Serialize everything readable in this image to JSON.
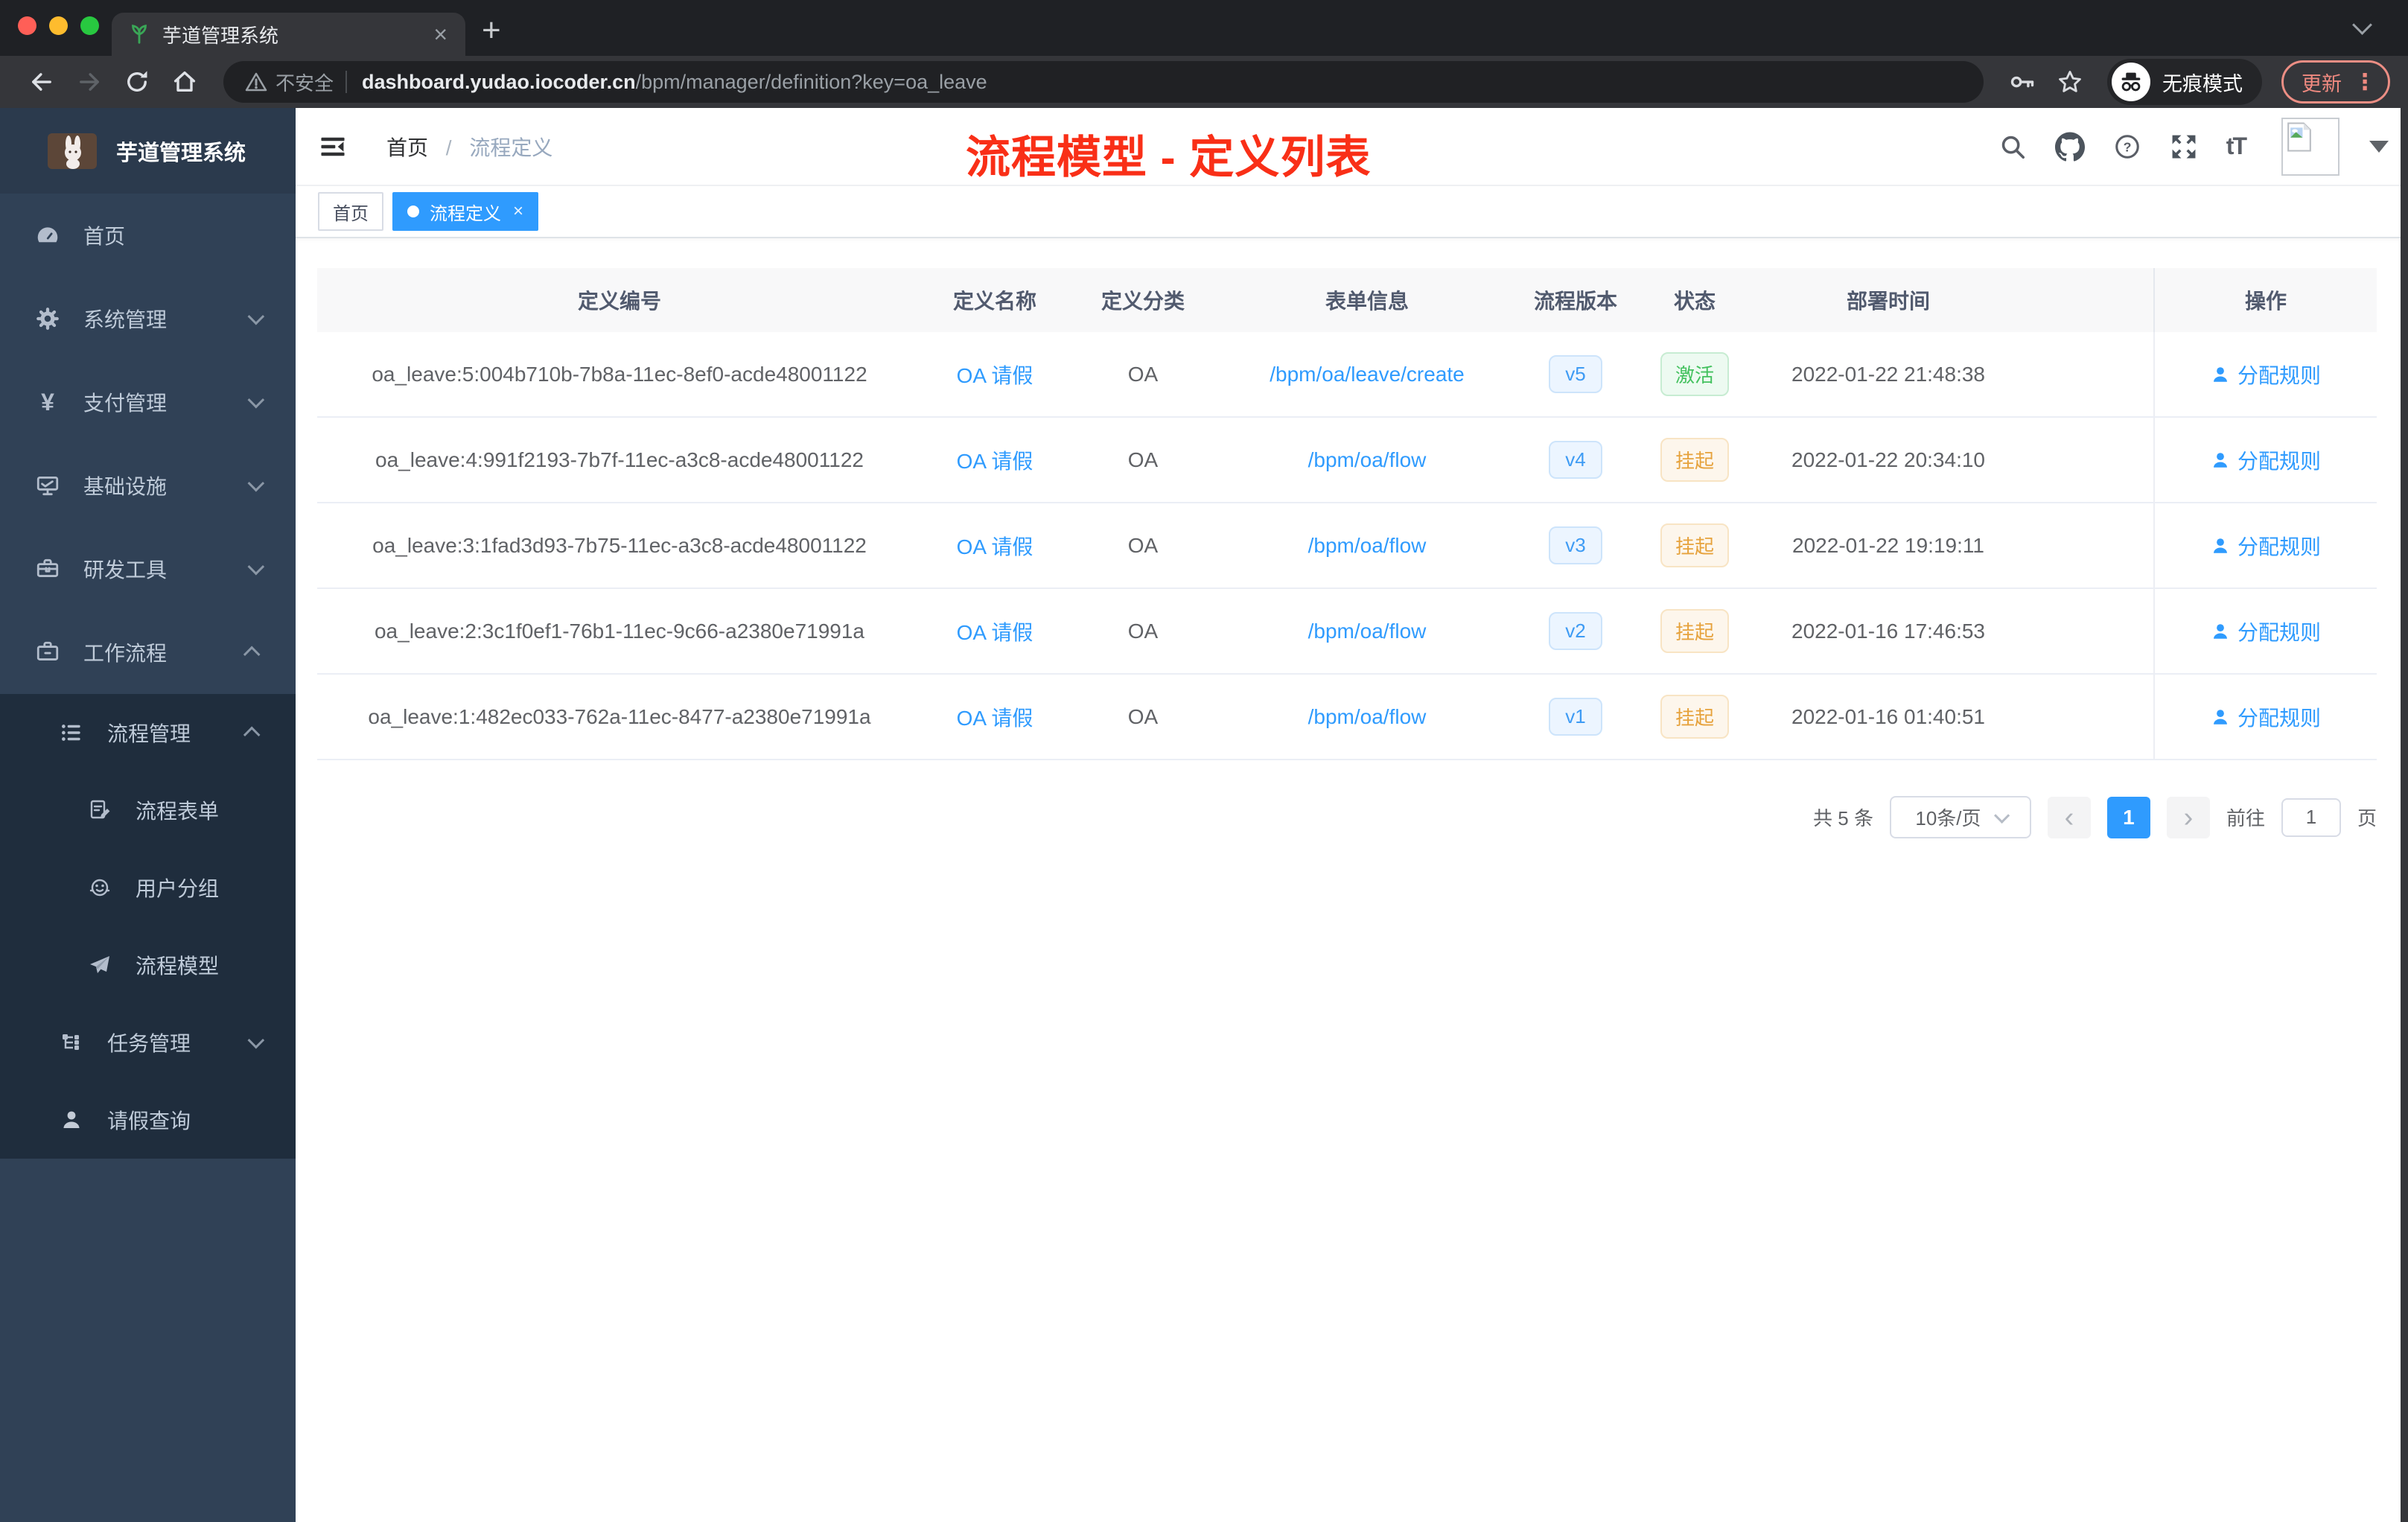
{
  "colors": {
    "accent": "#2f9bfe",
    "success": "#43c15e",
    "warning": "#e6a23c",
    "annotation_red": "#f92f17",
    "sidebar_bg": "#304156",
    "sidebar_sub_bg": "#1f2d3d"
  },
  "browser": {
    "tab_title": "芋道管理系统",
    "security": "不安全",
    "url_host": "dashboard.yudao.iocoder.cn",
    "url_path": "/bpm/manager/definition?key=oa_leave",
    "incognito": "无痕模式",
    "update": "更新"
  },
  "icons": {
    "close": "×",
    "new_tab": "+",
    "kebab": "⋮",
    "yen": "¥",
    "font_size": "tT",
    "prev": "‹",
    "next": "›"
  },
  "sidebar": {
    "app_title": "芋道管理系统",
    "items": [
      {
        "label": "首页"
      },
      {
        "label": "系统管理"
      },
      {
        "label": "支付管理"
      },
      {
        "label": "基础设施"
      },
      {
        "label": "研发工具"
      },
      {
        "label": "工作流程"
      }
    ],
    "sub": {
      "manage": {
        "label": "流程管理",
        "children": [
          {
            "label": "流程表单"
          },
          {
            "label": "用户分组"
          },
          {
            "label": "流程模型"
          }
        ]
      },
      "task": {
        "label": "任务管理"
      },
      "leave": {
        "label": "请假查询"
      }
    }
  },
  "header": {
    "breadcrumb_home": "首页",
    "breadcrumb_sep": "/",
    "breadcrumb_current": "流程定义",
    "annotation": "流程模型 - 定义列表"
  },
  "tags": {
    "home": "首页",
    "active": "流程定义"
  },
  "table": {
    "columns": [
      "定义编号",
      "定义名称",
      "定义分类",
      "表单信息",
      "流程版本",
      "状态",
      "部署时间",
      "操作"
    ],
    "rows": [
      {
        "id": "oa_leave:5:004b710b-7b8a-11ec-8ef0-acde48001122",
        "name": "OA 请假",
        "category": "OA",
        "form": "/bpm/oa/leave/create",
        "version": "v5",
        "status": "激活",
        "status_type": "success",
        "time": "2022-01-22 21:48:38",
        "action": "分配规则"
      },
      {
        "id": "oa_leave:4:991f2193-7b7f-11ec-a3c8-acde48001122",
        "name": "OA 请假",
        "category": "OA",
        "form": "/bpm/oa/flow",
        "version": "v4",
        "status": "挂起",
        "status_type": "warning",
        "time": "2022-01-22 20:34:10",
        "action": "分配规则"
      },
      {
        "id": "oa_leave:3:1fad3d93-7b75-11ec-a3c8-acde48001122",
        "name": "OA 请假",
        "category": "OA",
        "form": "/bpm/oa/flow",
        "version": "v3",
        "status": "挂起",
        "status_type": "warning",
        "time": "2022-01-22 19:19:11",
        "action": "分配规则"
      },
      {
        "id": "oa_leave:2:3c1f0ef1-76b1-11ec-9c66-a2380e71991a",
        "name": "OA 请假",
        "category": "OA",
        "form": "/bpm/oa/flow",
        "version": "v2",
        "status": "挂起",
        "status_type": "warning",
        "time": "2022-01-16 17:46:53",
        "action": "分配规则"
      },
      {
        "id": "oa_leave:1:482ec033-762a-11ec-8477-a2380e71991a",
        "name": "OA 请假",
        "category": "OA",
        "form": "/bpm/oa/flow",
        "version": "v1",
        "status": "挂起",
        "status_type": "warning",
        "time": "2022-01-16 01:40:51",
        "action": "分配规则"
      }
    ]
  },
  "pagination": {
    "total": "共 5 条",
    "size": "10条/页",
    "page": "1",
    "goto_label": "前往",
    "goto_value": "1",
    "unit": "页"
  }
}
